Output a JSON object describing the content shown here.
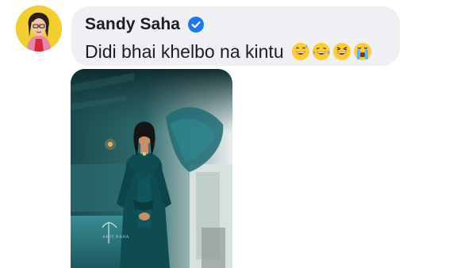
{
  "comment": {
    "author": "Sandy Saha",
    "verified": true,
    "text": "Didi bhai khelbo na kintu",
    "emojis": [
      "grinning-sweat-emoji",
      "tears-of-joy-emoji",
      "grinning-squint-emoji",
      "loudly-crying-emoji"
    ]
  },
  "attachment": {
    "watermark": "AMIT NAHA"
  },
  "colors": {
    "bubble": "#eef0f4",
    "verified": "#1877f2",
    "avatar_bg": "#f2cf2e",
    "photo_dress": "#0f4c52"
  }
}
